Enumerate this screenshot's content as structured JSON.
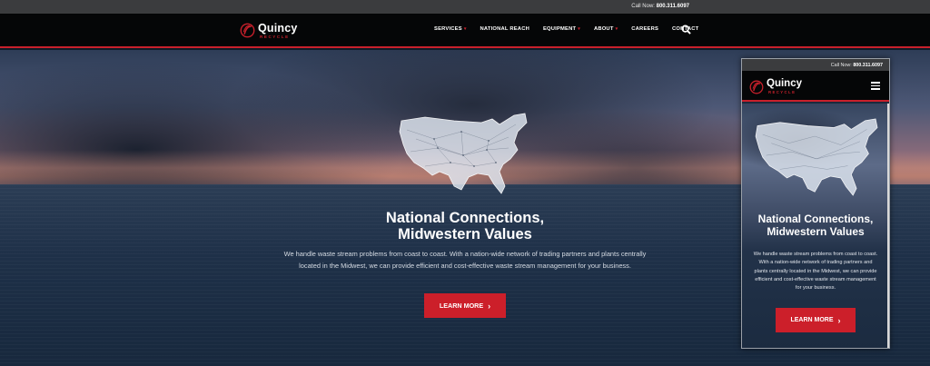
{
  "topbar": {
    "call_label": "Call Now:",
    "phone": "800.311.6097"
  },
  "brand": {
    "name": "Quincy",
    "tagline": "RECYCLE",
    "accent": "#c8202b"
  },
  "nav": {
    "items": [
      {
        "label": "SERVICES",
        "has_dropdown": true
      },
      {
        "label": "NATIONAL REACH",
        "has_dropdown": false
      },
      {
        "label": "EQUIPMENT",
        "has_dropdown": true
      },
      {
        "label": "ABOUT",
        "has_dropdown": true
      },
      {
        "label": "CAREERS",
        "has_dropdown": false
      },
      {
        "label": "CONTACT",
        "has_dropdown": false
      }
    ],
    "search_icon": "search-icon"
  },
  "hero": {
    "headline_line1": "National Connections,",
    "headline_line2": "Midwestern Values",
    "blurb_line1": "We handle waste stream problems from coast to coast. With a nation-wide network of trading partners and plants centrally",
    "blurb_line2": "located in the Midwest, we can provide efficient and cost-effective waste stream management for your business.",
    "cta_label": "LEARN MORE",
    "cta_color": "#cc1f2a"
  },
  "mobile": {
    "call_label": "Call Now:",
    "phone": "800.311.6097",
    "brand_name": "Quincy",
    "brand_tagline": "RECYCLE",
    "menu_icon": "hamburger-menu-icon",
    "headline_line1": "National Connections,",
    "headline_line2": "Midwestern Values",
    "blurb_lines": [
      "We handle waste stream problems from coast to coast.",
      "With a nation-wide network of trading partners and",
      "plants centrally located in the Midwest, we can provide",
      "efficient and cost-effective waste stream management",
      "for your business."
    ],
    "cta_label": "LEARN MORE"
  }
}
